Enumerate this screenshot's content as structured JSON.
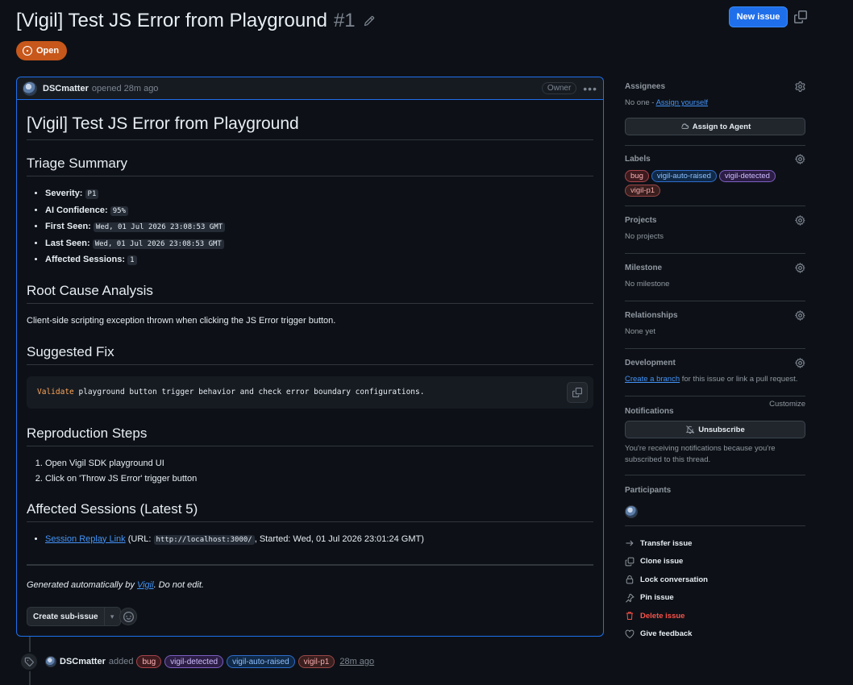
{
  "issue": {
    "title": "[Vigil] Test JS Error from Playground",
    "number": "#1",
    "state": "Open",
    "new_issue_label": "New issue"
  },
  "comment": {
    "author": "DSCmatter",
    "meta": "opened 28m ago",
    "role_badge": "Owner",
    "h1": "[Vigil] Test JS Error from Playground",
    "triage_heading": "Triage Summary",
    "triage_items": [
      {
        "key": "Severity:",
        "value": "P1"
      },
      {
        "key": "AI Confidence:",
        "value": "95%"
      },
      {
        "key": "First Seen:",
        "value": "Wed, 01 Jul 2026 23:08:53 GMT"
      },
      {
        "key": "Last Seen:",
        "value": "Wed, 01 Jul 2026 23:08:53 GMT"
      },
      {
        "key": "Affected Sessions:",
        "value": "1"
      }
    ],
    "rca_heading": "Root Cause Analysis",
    "rca_text": "Client-side scripting exception thrown when clicking the JS Error trigger button.",
    "fix_heading": "Suggested Fix",
    "fix_keyword": "Validate",
    "fix_code": " playground button trigger behavior and check error boundary configurations.",
    "repro_heading": "Reproduction Steps",
    "repro_steps": [
      "Open Vigil SDK playground UI",
      "Click on 'Throw JS Error' trigger button"
    ],
    "sessions_heading": "Affected Sessions (Latest 5)",
    "session_link": "Session Replay Link",
    "session_prefix": " (URL: ",
    "session_url": "http://localhost:3000/",
    "session_suffix": ", Started: Wed, 01 Jul 2026 23:01:24 GMT)",
    "footer_prefix": "Generated automatically by ",
    "footer_link": "Vigil",
    "footer_suffix": ". Do not edit.",
    "sub_issue_label": "Create sub-issue"
  },
  "event": {
    "author": "DSCmatter",
    "action": "added",
    "labels": [
      "bug",
      "vigil-detected",
      "vigil-auto-raised",
      "vigil-p1"
    ],
    "time": "28m ago"
  },
  "sidebar": {
    "assignees": {
      "title": "Assignees",
      "none": "No one - ",
      "assign_link": "Assign yourself",
      "agent_button": "Assign to Agent"
    },
    "labels": {
      "title": "Labels",
      "items": [
        "bug",
        "vigil-auto-raised",
        "vigil-detected",
        "vigil-p1"
      ]
    },
    "projects": {
      "title": "Projects",
      "value": "No projects"
    },
    "milestone": {
      "title": "Milestone",
      "value": "No milestone"
    },
    "relationships": {
      "title": "Relationships",
      "value": "None yet"
    },
    "development": {
      "title": "Development",
      "link": "Create a branch",
      "text": " for this issue or link a pull request."
    },
    "notifications": {
      "title": "Notifications",
      "customize": "Customize",
      "button": "Unsubscribe",
      "text": "You're receiving notifications because you're subscribed to this thread."
    },
    "participants": {
      "title": "Participants"
    },
    "actions": [
      "Transfer issue",
      "Clone issue",
      "Lock conversation",
      "Pin issue",
      "Delete issue",
      "Give feedback"
    ]
  },
  "colors": {
    "accent": "#1f6feb",
    "open": "#c7571b",
    "danger": "#f85149",
    "link": "#4493f8"
  }
}
